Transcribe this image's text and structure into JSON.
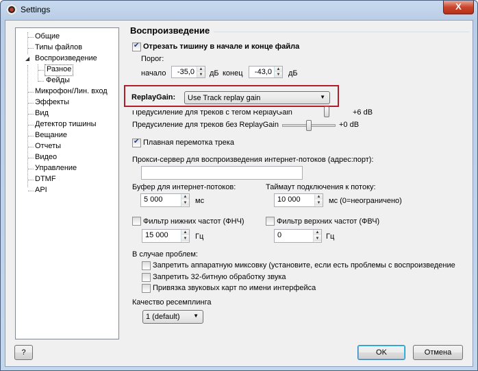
{
  "window": {
    "title": "Settings",
    "close_label": "X"
  },
  "tree": {
    "items": [
      {
        "label": "Общие"
      },
      {
        "label": "Типы файлов"
      },
      {
        "label": "Воспроизведение"
      },
      {
        "label": "Разное"
      },
      {
        "label": "Фейды"
      },
      {
        "label": "Микрофон/Лин. вход"
      },
      {
        "label": "Эффекты"
      },
      {
        "label": "Вид"
      },
      {
        "label": "Детектор тишины"
      },
      {
        "label": "Вещание"
      },
      {
        "label": "Отчеты"
      },
      {
        "label": "Видео"
      },
      {
        "label": "Управление"
      },
      {
        "label": "DTMF"
      },
      {
        "label": "API"
      }
    ],
    "selected": "Разное"
  },
  "section": {
    "title": "Воспроизведение"
  },
  "trim": {
    "label": "Отрезать тишину в начале и конце файла",
    "checked": true,
    "threshold_label": "Порог:",
    "start_label": "начало",
    "start_value": "-35,0",
    "start_unit": "дБ",
    "end_label": "конец",
    "end_value": "-43,0",
    "end_unit": "дБ"
  },
  "replaygain": {
    "label": "ReplayGain:",
    "selected": "Use Track replay gain",
    "preamp_tag_label": "Предусиление для треков с тегом ReplayGain",
    "preamp_tag_value": "+6 dB",
    "preamp_tag_level": 1.0,
    "preamp_notag_label": "Предусиление для треков без ReplayGain",
    "preamp_notag_value": "+0 dB",
    "preamp_notag_level": 0.5
  },
  "smooth_seek": {
    "label": "Плавная перемотка трека",
    "checked": true
  },
  "proxy": {
    "label": "Прокси-сервер для воспроизведения интернет-потоков (адрес:порт):",
    "value": ""
  },
  "buffer": {
    "label": "Буфер для интернет-потоков:",
    "value": "5 000",
    "unit": "мс"
  },
  "timeout": {
    "label": "Таймаут подключения к потоку:",
    "value": "10 000",
    "unit": "мс (0=неограничено)"
  },
  "lowpass": {
    "label": "Фильтр нижних частот (ФНЧ)",
    "checked": false,
    "value": "15 000",
    "unit": "Гц"
  },
  "highpass": {
    "label": "Фильтр верхних частот (ФВЧ)",
    "checked": false,
    "value": "0",
    "unit": "Гц"
  },
  "problems": {
    "label": "В случае проблем:",
    "options": [
      {
        "label": "Запретить аппаратную миксовку (установите, если есть проблемы с воспроизведение",
        "checked": false
      },
      {
        "label": "Запретить 32-битную обработку звука",
        "checked": false
      },
      {
        "label": "Привязка звуковых карт по имени интерфейса",
        "checked": false
      }
    ]
  },
  "resampling": {
    "label": "Качество ресемплинга",
    "selected": "1 (default)"
  },
  "buttons": {
    "help": "?",
    "ok": "OK",
    "cancel": "Отмена"
  },
  "colors": {
    "highlight_border": "#b01c2a",
    "title_bar": "#c2d6ec"
  }
}
